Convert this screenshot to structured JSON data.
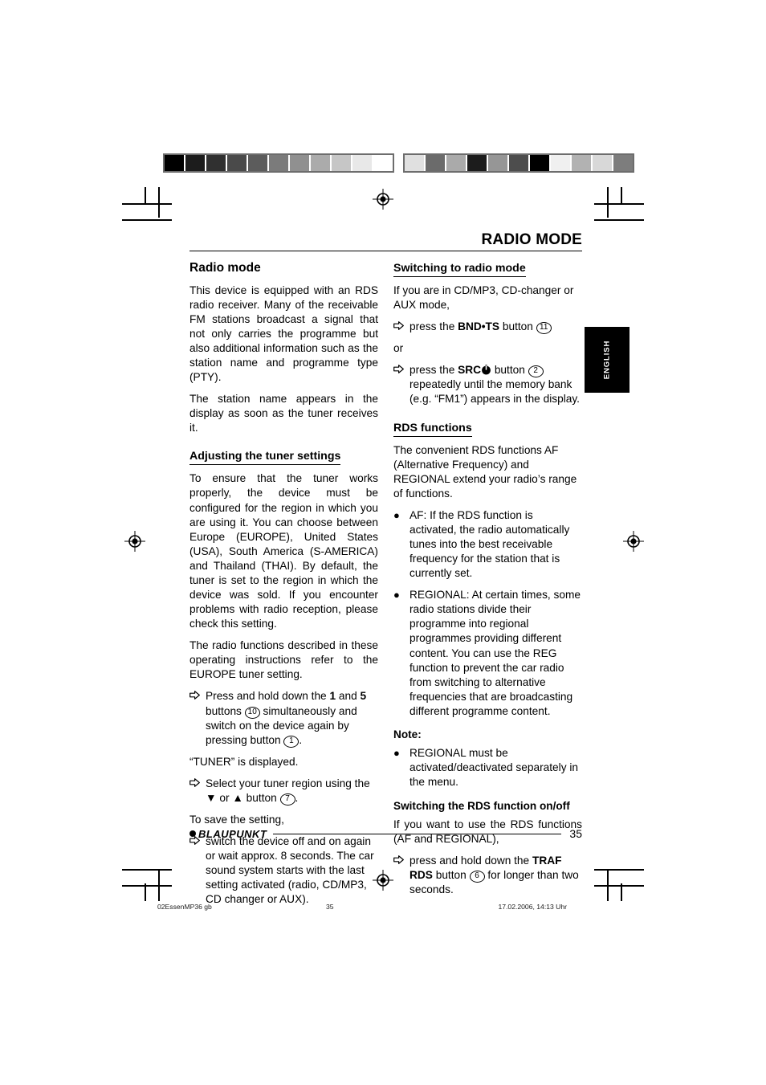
{
  "running_head": "RADIO MODE",
  "language_tab": "ENGLISH",
  "calibration": {
    "left_bar": [
      "#000000",
      "#1c1c1c",
      "#303030",
      "#4a4a4a",
      "#5c5c5c",
      "#7b7b7b",
      "#909090",
      "#ababab",
      "#c6c6c6",
      "#e8e8e8",
      "#ffffff"
    ],
    "right_bar": [
      "#e0e0e0",
      "#6b6b6b",
      "#aaaaaa",
      "#1c1c1c",
      "#969696",
      "#4d4d4d",
      "#000000",
      "#f0f0f0",
      "#b2b2b2",
      "#d8d8d8",
      "#7d7d7d"
    ]
  },
  "left_column": {
    "heading": "Radio mode",
    "p1": "This device is equipped with an RDS radio receiver. Many of the receivable FM stations broadcast a signal that not only carries the programme but also additional information such as the station name and programme type (PTY).",
    "p2": "The station name appears in the display as soon as the tuner receives it.",
    "subheading": "Adjusting the tuner settings",
    "p3": "To ensure that the tuner works properly, the device must be configured for the region in which you are using it. You can choose between Europe (EUROPE), United States (USA), South America (S-AMERICA) and Thailand (THAI). By default, the tuner is set to the region in which the device was sold. If you encounter problems with radio reception, please check this setting.",
    "p4": "The radio functions described in these operating instructions refer to the EUROPE tuner setting.",
    "step1": {
      "marker": "arrow-right-outline-icon",
      "t1": "Press and hold down the ",
      "b1": "1",
      "t2": " and ",
      "b2": "5",
      "t3": " buttons ",
      "ref1": "10",
      "t4": " simultaneously and switch on the device again by pressing button ",
      "ref2": "1",
      "t5": "."
    },
    "p5": "“TUNER” is displayed.",
    "step2": {
      "marker": "arrow-right-outline-icon",
      "t1": "Select your tuner region using the ▼ or ▲ button ",
      "ref1": "7",
      "t2": "."
    },
    "p6": "To save the setting,",
    "step3": {
      "marker": "arrow-right-outline-icon",
      "t1": "switch the device off and on again or wait approx. 8 seconds. The car sound system starts with the last setting activated (radio, CD/MP3, CD changer or AUX)."
    }
  },
  "right_column": {
    "sub1": "Switching to radio mode",
    "p1": "If you are in CD/MP3, CD-changer or AUX mode,",
    "step1": {
      "marker": "arrow-right-outline-icon",
      "t1": "press the ",
      "b1": "BND•TS",
      "t2": " button ",
      "ref1": "11"
    },
    "or": "or",
    "step2": {
      "marker": "arrow-right-outline-icon",
      "t1": "press the ",
      "b1": "SRC",
      "icon": "power-icon",
      "t2": " button ",
      "ref1": "2",
      "t3": " repeatedly until the memory bank (e.g. “FM1”) appears in the display."
    },
    "sub2": "RDS functions",
    "p2": "The convenient RDS functions AF (Alternative Frequency) and REGIONAL extend your radio’s range of functions.",
    "bullet1": {
      "marker": "dot-bullet-icon",
      "text": "AF: If the RDS function is activated, the radio automatically tunes into the best receivable frequency for the station that is currently set."
    },
    "bullet2": {
      "marker": "dot-bullet-icon",
      "text": "REGIONAL: At certain times, some radio stations divide their programme into regional programmes providing different content. You can use the REG function to prevent the car radio from switching to alternative frequencies that are broadcasting different programme content."
    },
    "note_heading": "Note:",
    "note_bullet": {
      "marker": "dot-bullet-icon",
      "text": "REGIONAL must be activated/deactivated separately in the menu."
    },
    "sub3": "Switching the RDS function on/off",
    "p3": "If you want to use the RDS functions (AF and REGIONAL),",
    "step3": {
      "marker": "arrow-right-outline-icon",
      "t1": "press and hold down the ",
      "b1": "TRAF RDS",
      "t2": " button ",
      "ref1": "6",
      "t3": " for longer than two seconds."
    }
  },
  "footer": {
    "logo_text": "BLAUPUNKT",
    "page_number": "35"
  },
  "meta": {
    "file": "02EssenMP36 gb",
    "page": "35",
    "timestamp": "17.02.2006, 14:13 Uhr"
  }
}
